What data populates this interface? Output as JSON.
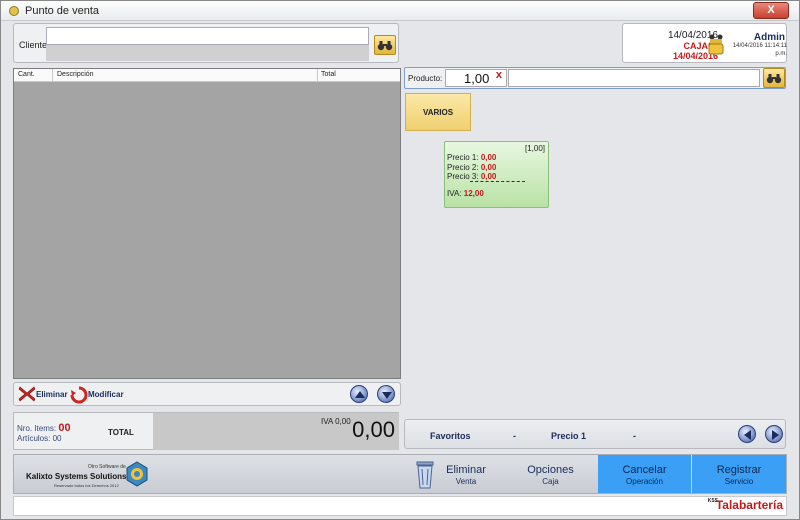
{
  "window": {
    "title": "Punto de venta",
    "close_label": "X"
  },
  "client": {
    "label": "Cliente:",
    "value": ""
  },
  "session": {
    "date": "14/04/2016",
    "caja": "CAJA02",
    "caja_date": "14/04/2016",
    "user": "Admin",
    "user_datetime": "14/04/2016 11:14:11",
    "user_ampm": "p.m."
  },
  "grid": {
    "columns": [
      "Cant.",
      "Descripción",
      "Total"
    ],
    "rows": []
  },
  "actions": {
    "delete_label": "Eliminar",
    "modify_label": "Modificar"
  },
  "totals": {
    "items_label": "Nro. Items:",
    "items_value": "00",
    "articles_label": "Artículos: 00",
    "total_label": "TOTAL",
    "iva_label": "IVA 0,00",
    "total_value": "0,00"
  },
  "product": {
    "label": "Producto:",
    "qty": "1,00",
    "clear": "x",
    "code": ""
  },
  "category": {
    "label": "VARIOS"
  },
  "card": {
    "qty": "[1,00]",
    "p1_label": "Precio 1:",
    "p1": "0,00",
    "p2_label": "Precio 2:",
    "p2": "0,00",
    "p3_label": "Precio 3:",
    "p3": "0,00",
    "iva_label": "IVA:",
    "iva": "12,00"
  },
  "favorites": {
    "label": "Favoritos",
    "sep1": "-",
    "price_label": "Precio 1",
    "sep2": "-"
  },
  "footer": {
    "logo_small": "Otro Software de",
    "logo_name": "Kalixto Systems Solutions",
    "logo_rights": "Reservado todos los Derechos 2012",
    "btn_delete": {
      "l1": "Eliminar",
      "l2": "Venta"
    },
    "btn_options": {
      "l1": "Opciones",
      "l2": "Caja"
    },
    "btn_cancel": {
      "l1": "Cancelar",
      "l2": "Operación"
    },
    "btn_register": {
      "l1": "Registrar",
      "l2": "Servicio"
    }
  },
  "status": {
    "brand_pre": "KSS",
    "brand": "Talabartería"
  },
  "colors": {
    "accent_red": "#c2191b",
    "register_blue": "#3ba0f5",
    "navy": "#1a2d5a"
  }
}
